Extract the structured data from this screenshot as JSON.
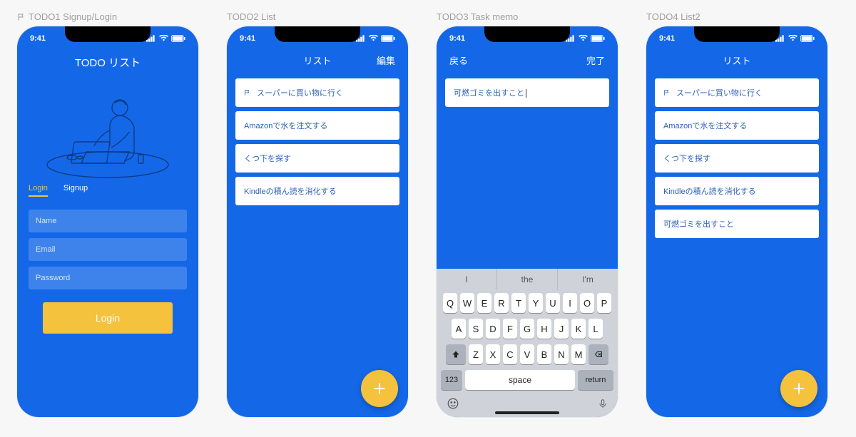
{
  "status": {
    "time": "9:41"
  },
  "frames": {
    "f1": "TODO1 Signup/Login",
    "f2": "TODO2 List",
    "f3": "TODO3 Task memo",
    "f4": "TODO4 List2"
  },
  "colors": {
    "primary": "#1468e8",
    "accent": "#f5c23d"
  },
  "screen1": {
    "title": "TODO リスト",
    "tabs": {
      "login": "Login",
      "signup": "Signup"
    },
    "fields": {
      "name": "Name",
      "email": "Email",
      "password": "Password"
    },
    "button": "Login"
  },
  "screen2": {
    "nav": {
      "title": "リスト",
      "right": "編集"
    },
    "items": [
      "スーパーに買い物に行く",
      "Amazonで水を注文する",
      "くつ下を探す",
      "Kindleの積ん読を消化する"
    ]
  },
  "screen3": {
    "nav": {
      "left": "戻る",
      "right": "完了"
    },
    "input": "可燃ゴミを出すこと",
    "suggestions": [
      "I",
      "the",
      "I'm"
    ],
    "keyboard": {
      "r1": [
        "Q",
        "W",
        "E",
        "R",
        "T",
        "Y",
        "U",
        "I",
        "O",
        "P"
      ],
      "r2": [
        "A",
        "S",
        "D",
        "F",
        "G",
        "H",
        "J",
        "K",
        "L"
      ],
      "r3": [
        "Z",
        "X",
        "C",
        "V",
        "B",
        "N",
        "M"
      ],
      "num": "123",
      "space": "space",
      "return": "return"
    }
  },
  "screen4": {
    "nav": {
      "title": "リスト"
    },
    "items": [
      "スーパーに買い物に行く",
      "Amazonで水を注文する",
      "くつ下を探す",
      "Kindleの積ん読を消化する",
      "可燃ゴミを出すこと"
    ]
  }
}
